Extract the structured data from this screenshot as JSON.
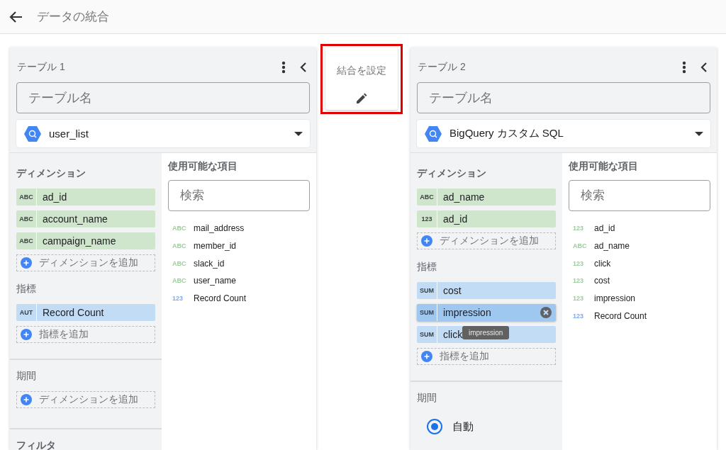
{
  "header": {
    "title": "データの統合"
  },
  "join": {
    "label": "結合を設定",
    "highlighted": true
  },
  "tables": [
    {
      "title": "テーブル 1",
      "name_placeholder": "テーブル名",
      "source": "user_list",
      "available_title": "使用可能な項目",
      "search_placeholder": "検索",
      "sections": [
        {
          "kind": "dimensions",
          "title": "ディメンション",
          "chips": [
            {
              "type": "ABC",
              "name": "ad_id",
              "hovered": false
            },
            {
              "type": "ABC",
              "name": "account_name",
              "hovered": false
            },
            {
              "type": "ABC",
              "name": "campaign_name",
              "hovered": false
            }
          ],
          "add_label": "ディメンションを追加"
        },
        {
          "kind": "metrics",
          "title": "指標",
          "chips": [
            {
              "type": "AUT",
              "name": "Record Count",
              "hovered": false
            }
          ],
          "add_label": "指標を追加"
        },
        {
          "kind": "date",
          "title": "期間",
          "add_label": "ディメンションを追加"
        },
        {
          "kind": "heading",
          "title": "フィルタ"
        }
      ],
      "available": [
        {
          "type": "ABC",
          "name": "mail_address",
          "color": "#9ccc9c"
        },
        {
          "type": "ABC",
          "name": "member_id",
          "color": "#9ccc9c"
        },
        {
          "type": "ABC",
          "name": "slack_id",
          "color": "#9ccc9c"
        },
        {
          "type": "ABC",
          "name": "user_name",
          "color": "#9ccc9c"
        },
        {
          "type": "123",
          "name": "Record Count",
          "color": "#7baaf7"
        }
      ]
    },
    {
      "title": "テーブル 2",
      "name_placeholder": "テーブル名",
      "source": "BigQuery カスタム SQL",
      "available_title": "使用可能な項目",
      "search_placeholder": "検索",
      "sections": [
        {
          "kind": "dimensions",
          "title": "ディメンション",
          "chips": [
            {
              "type": "ABC",
              "name": "ad_name",
              "hovered": false
            },
            {
              "type": "123",
              "name": "ad_id",
              "hovered": false
            }
          ],
          "add_label": "ディメンションを追加"
        },
        {
          "kind": "metrics",
          "title": "指標",
          "chips": [
            {
              "type": "SUM",
              "name": "cost",
              "hovered": false
            },
            {
              "type": "SUM",
              "name": "impression",
              "hovered": true
            },
            {
              "type": "SUM",
              "name": "click",
              "hovered": false,
              "tooltip": "impression"
            }
          ],
          "add_label": "指標を追加"
        },
        {
          "kind": "radios",
          "title": "期間",
          "options": [
            {
              "label": "自動",
              "selected": true
            }
          ]
        }
      ],
      "available": [
        {
          "type": "123",
          "name": "ad_id",
          "color": "#9ccc9c"
        },
        {
          "type": "ABC",
          "name": "ad_name",
          "color": "#9ccc9c"
        },
        {
          "type": "123",
          "name": "click",
          "color": "#9ccc9c"
        },
        {
          "type": "123",
          "name": "cost",
          "color": "#9ccc9c"
        },
        {
          "type": "123",
          "name": "impression",
          "color": "#9ccc9c"
        },
        {
          "type": "123",
          "name": "Record Count",
          "color": "#7baaf7"
        }
      ]
    }
  ]
}
